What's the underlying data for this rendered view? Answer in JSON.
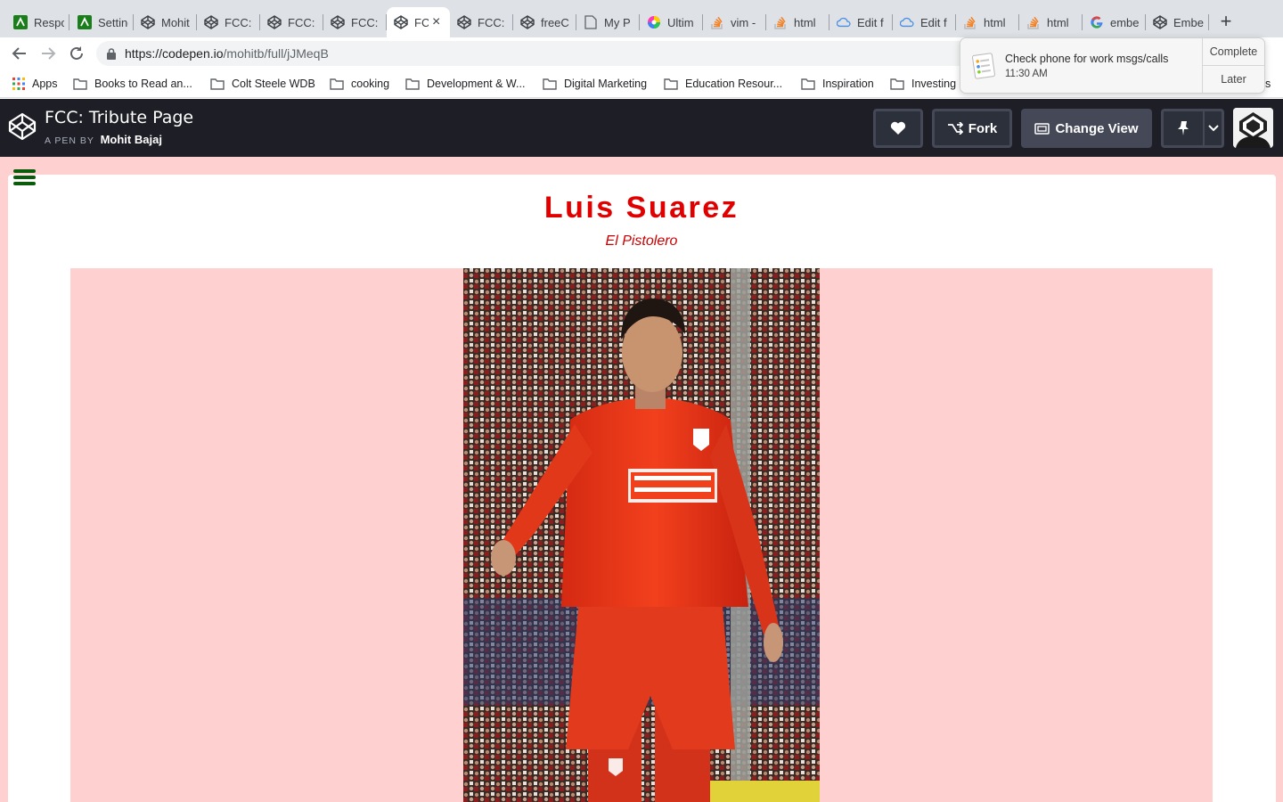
{
  "browser": {
    "tabs": [
      {
        "title": "Responsive",
        "icon": "green-app-icon"
      },
      {
        "title": "Settings",
        "icon": "green-app-icon"
      },
      {
        "title": "Mohit",
        "icon": "codepen-icon"
      },
      {
        "title": "FCC:",
        "icon": "codepen-icon"
      },
      {
        "title": "FCC:",
        "icon": "codepen-icon"
      },
      {
        "title": "FCC:",
        "icon": "codepen-icon"
      },
      {
        "title": "FC",
        "icon": "codepen-icon",
        "active": true
      },
      {
        "title": "FCC:",
        "icon": "codepen-icon"
      },
      {
        "title": "freeC",
        "icon": "codepen-icon"
      },
      {
        "title": "My P",
        "icon": "document-icon"
      },
      {
        "title": "Ultim",
        "icon": "color-wheel-icon"
      },
      {
        "title": "vim -",
        "icon": "stackoverflow-icon"
      },
      {
        "title": "html",
        "icon": "stackoverflow-icon"
      },
      {
        "title": "Edit f",
        "icon": "cloud-icon"
      },
      {
        "title": "Edit f",
        "icon": "cloud-icon"
      },
      {
        "title": "html",
        "icon": "stackoverflow-icon"
      },
      {
        "title": "html",
        "icon": "stackoverflow-icon"
      },
      {
        "title": "embe",
        "icon": "google-icon"
      },
      {
        "title": "Embe",
        "icon": "codepen-icon"
      }
    ],
    "new_tab": "+",
    "close_tab": "×",
    "url_host": "https://codepen.io",
    "url_path": "/mohitb/full/jJMeqB",
    "bookmarks": [
      {
        "label": "Apps",
        "icon": "apps-grid-icon"
      },
      {
        "label": "Books to Read an...",
        "icon": "folder-icon"
      },
      {
        "label": "Colt Steele WDB",
        "icon": "folder-icon"
      },
      {
        "label": "cooking",
        "icon": "folder-icon"
      },
      {
        "label": "Development & W...",
        "icon": "folder-icon"
      },
      {
        "label": "Digital Marketing",
        "icon": "folder-icon"
      },
      {
        "label": "Education Resour...",
        "icon": "folder-icon"
      },
      {
        "label": "Inspiration",
        "icon": "folder-icon"
      },
      {
        "label": "Investing",
        "icon": "folder-icon"
      },
      {
        "label": "s",
        "icon": ""
      }
    ]
  },
  "notification": {
    "title": "Check phone for work msgs/calls",
    "time": "11:30 AM",
    "complete_label": "Complete",
    "later_label": "Later"
  },
  "codepen": {
    "pen_title": "FCC: Tribute Page",
    "by_label": "A PEN BY",
    "author": "Mohit Bajaj",
    "fork_label": "Fork",
    "change_view_label": "Change View"
  },
  "content": {
    "title": "Luis Suarez",
    "subtitle": "El Pistolero"
  },
  "colors": {
    "page_background": "#ffd0d0",
    "title_red": "#e00000",
    "hamburger_green": "#0a5c0a",
    "codepen_bar": "#1e1f26"
  }
}
